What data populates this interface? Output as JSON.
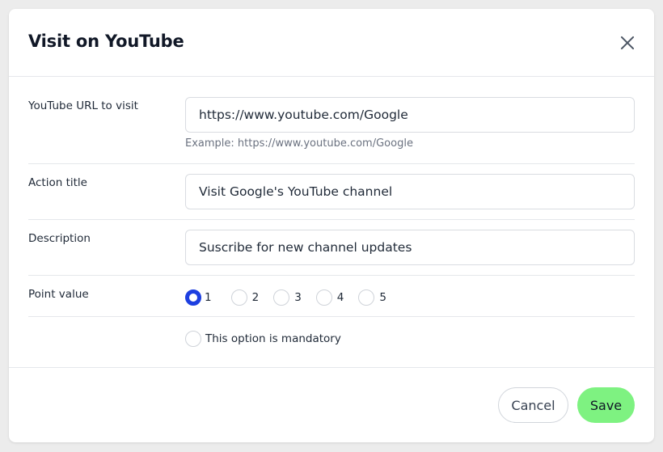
{
  "modal": {
    "title": "Visit on YouTube"
  },
  "form": {
    "url": {
      "label": "YouTube URL to visit",
      "value": "https://www.youtube.com/Google",
      "hint": "Example: https://www.youtube.com/Google"
    },
    "action_title": {
      "label": "Action title",
      "value": "Visit Google's YouTube channel"
    },
    "description": {
      "label": "Description",
      "value": "Suscribe for new channel updates"
    },
    "point_value": {
      "label": "Point value",
      "options": [
        "1",
        "2",
        "3",
        "4",
        "5"
      ],
      "selected": "1"
    },
    "mandatory": {
      "label": "This option is mandatory",
      "checked": false
    }
  },
  "footer": {
    "cancel_label": "Cancel",
    "save_label": "Save"
  },
  "colors": {
    "accent": "#1d3fe0",
    "save": "#7ef281"
  },
  "icons": {
    "close": "close-icon"
  }
}
